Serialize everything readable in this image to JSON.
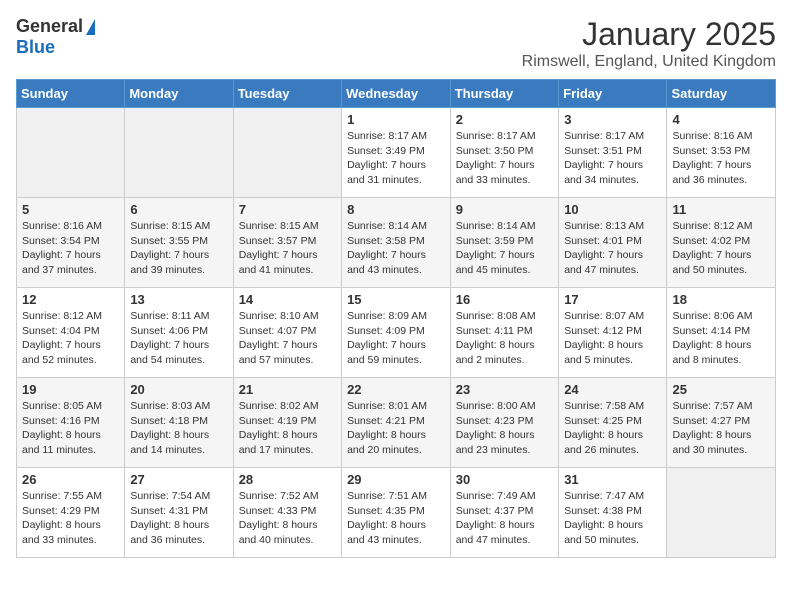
{
  "header": {
    "logo_general": "General",
    "logo_blue": "Blue",
    "month_title": "January 2025",
    "location": "Rimswell, England, United Kingdom"
  },
  "weekdays": [
    "Sunday",
    "Monday",
    "Tuesday",
    "Wednesday",
    "Thursday",
    "Friday",
    "Saturday"
  ],
  "weeks": [
    [
      {
        "day": "",
        "sunrise": "",
        "sunset": "",
        "daylight": ""
      },
      {
        "day": "",
        "sunrise": "",
        "sunset": "",
        "daylight": ""
      },
      {
        "day": "",
        "sunrise": "",
        "sunset": "",
        "daylight": ""
      },
      {
        "day": "1",
        "sunrise": "Sunrise: 8:17 AM",
        "sunset": "Sunset: 3:49 PM",
        "daylight": "Daylight: 7 hours and 31 minutes."
      },
      {
        "day": "2",
        "sunrise": "Sunrise: 8:17 AM",
        "sunset": "Sunset: 3:50 PM",
        "daylight": "Daylight: 7 hours and 33 minutes."
      },
      {
        "day": "3",
        "sunrise": "Sunrise: 8:17 AM",
        "sunset": "Sunset: 3:51 PM",
        "daylight": "Daylight: 7 hours and 34 minutes."
      },
      {
        "day": "4",
        "sunrise": "Sunrise: 8:16 AM",
        "sunset": "Sunset: 3:53 PM",
        "daylight": "Daylight: 7 hours and 36 minutes."
      }
    ],
    [
      {
        "day": "5",
        "sunrise": "Sunrise: 8:16 AM",
        "sunset": "Sunset: 3:54 PM",
        "daylight": "Daylight: 7 hours and 37 minutes."
      },
      {
        "day": "6",
        "sunrise": "Sunrise: 8:15 AM",
        "sunset": "Sunset: 3:55 PM",
        "daylight": "Daylight: 7 hours and 39 minutes."
      },
      {
        "day": "7",
        "sunrise": "Sunrise: 8:15 AM",
        "sunset": "Sunset: 3:57 PM",
        "daylight": "Daylight: 7 hours and 41 minutes."
      },
      {
        "day": "8",
        "sunrise": "Sunrise: 8:14 AM",
        "sunset": "Sunset: 3:58 PM",
        "daylight": "Daylight: 7 hours and 43 minutes."
      },
      {
        "day": "9",
        "sunrise": "Sunrise: 8:14 AM",
        "sunset": "Sunset: 3:59 PM",
        "daylight": "Daylight: 7 hours and 45 minutes."
      },
      {
        "day": "10",
        "sunrise": "Sunrise: 8:13 AM",
        "sunset": "Sunset: 4:01 PM",
        "daylight": "Daylight: 7 hours and 47 minutes."
      },
      {
        "day": "11",
        "sunrise": "Sunrise: 8:12 AM",
        "sunset": "Sunset: 4:02 PM",
        "daylight": "Daylight: 7 hours and 50 minutes."
      }
    ],
    [
      {
        "day": "12",
        "sunrise": "Sunrise: 8:12 AM",
        "sunset": "Sunset: 4:04 PM",
        "daylight": "Daylight: 7 hours and 52 minutes."
      },
      {
        "day": "13",
        "sunrise": "Sunrise: 8:11 AM",
        "sunset": "Sunset: 4:06 PM",
        "daylight": "Daylight: 7 hours and 54 minutes."
      },
      {
        "day": "14",
        "sunrise": "Sunrise: 8:10 AM",
        "sunset": "Sunset: 4:07 PM",
        "daylight": "Daylight: 7 hours and 57 minutes."
      },
      {
        "day": "15",
        "sunrise": "Sunrise: 8:09 AM",
        "sunset": "Sunset: 4:09 PM",
        "daylight": "Daylight: 7 hours and 59 minutes."
      },
      {
        "day": "16",
        "sunrise": "Sunrise: 8:08 AM",
        "sunset": "Sunset: 4:11 PM",
        "daylight": "Daylight: 8 hours and 2 minutes."
      },
      {
        "day": "17",
        "sunrise": "Sunrise: 8:07 AM",
        "sunset": "Sunset: 4:12 PM",
        "daylight": "Daylight: 8 hours and 5 minutes."
      },
      {
        "day": "18",
        "sunrise": "Sunrise: 8:06 AM",
        "sunset": "Sunset: 4:14 PM",
        "daylight": "Daylight: 8 hours and 8 minutes."
      }
    ],
    [
      {
        "day": "19",
        "sunrise": "Sunrise: 8:05 AM",
        "sunset": "Sunset: 4:16 PM",
        "daylight": "Daylight: 8 hours and 11 minutes."
      },
      {
        "day": "20",
        "sunrise": "Sunrise: 8:03 AM",
        "sunset": "Sunset: 4:18 PM",
        "daylight": "Daylight: 8 hours and 14 minutes."
      },
      {
        "day": "21",
        "sunrise": "Sunrise: 8:02 AM",
        "sunset": "Sunset: 4:19 PM",
        "daylight": "Daylight: 8 hours and 17 minutes."
      },
      {
        "day": "22",
        "sunrise": "Sunrise: 8:01 AM",
        "sunset": "Sunset: 4:21 PM",
        "daylight": "Daylight: 8 hours and 20 minutes."
      },
      {
        "day": "23",
        "sunrise": "Sunrise: 8:00 AM",
        "sunset": "Sunset: 4:23 PM",
        "daylight": "Daylight: 8 hours and 23 minutes."
      },
      {
        "day": "24",
        "sunrise": "Sunrise: 7:58 AM",
        "sunset": "Sunset: 4:25 PM",
        "daylight": "Daylight: 8 hours and 26 minutes."
      },
      {
        "day": "25",
        "sunrise": "Sunrise: 7:57 AM",
        "sunset": "Sunset: 4:27 PM",
        "daylight": "Daylight: 8 hours and 30 minutes."
      }
    ],
    [
      {
        "day": "26",
        "sunrise": "Sunrise: 7:55 AM",
        "sunset": "Sunset: 4:29 PM",
        "daylight": "Daylight: 8 hours and 33 minutes."
      },
      {
        "day": "27",
        "sunrise": "Sunrise: 7:54 AM",
        "sunset": "Sunset: 4:31 PM",
        "daylight": "Daylight: 8 hours and 36 minutes."
      },
      {
        "day": "28",
        "sunrise": "Sunrise: 7:52 AM",
        "sunset": "Sunset: 4:33 PM",
        "daylight": "Daylight: 8 hours and 40 minutes."
      },
      {
        "day": "29",
        "sunrise": "Sunrise: 7:51 AM",
        "sunset": "Sunset: 4:35 PM",
        "daylight": "Daylight: 8 hours and 43 minutes."
      },
      {
        "day": "30",
        "sunrise": "Sunrise: 7:49 AM",
        "sunset": "Sunset: 4:37 PM",
        "daylight": "Daylight: 8 hours and 47 minutes."
      },
      {
        "day": "31",
        "sunrise": "Sunrise: 7:47 AM",
        "sunset": "Sunset: 4:38 PM",
        "daylight": "Daylight: 8 hours and 50 minutes."
      },
      {
        "day": "",
        "sunrise": "",
        "sunset": "",
        "daylight": ""
      }
    ]
  ]
}
